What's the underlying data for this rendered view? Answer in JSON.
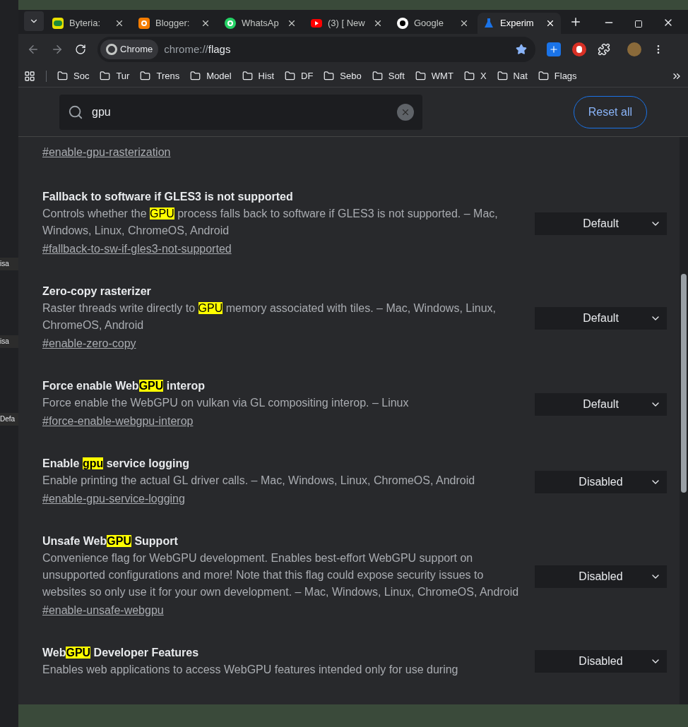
{
  "background_window": {
    "fragments": [
      "isa",
      "isa",
      "Defa"
    ]
  },
  "tabs": [
    {
      "title": "Byteria:",
      "selected": false
    },
    {
      "title": "Blogger:",
      "selected": false
    },
    {
      "title": "WhatsAp",
      "selected": false
    },
    {
      "title": "(3) [ New",
      "selected": false
    },
    {
      "title": "Google",
      "selected": false
    },
    {
      "title": "Experim",
      "selected": true
    }
  ],
  "toolbar": {
    "site_chip": "Chrome",
    "url_scheme": "chrome://",
    "url_path": "flags"
  },
  "bookmarks": [
    "Soc",
    "Tur",
    "Trens",
    "Model",
    "Hist",
    "DF",
    "Sebo",
    "Soft",
    "WMT",
    "X",
    "Nat",
    "Flags"
  ],
  "search": {
    "value": "gpu"
  },
  "reset_button": "Reset all",
  "flags": [
    {
      "link": "#enable-gpu-rasterization"
    },
    {
      "title": {
        "before": "Fallback to software if GLES3 is not supported"
      },
      "description": {
        "before": "Controls whether the ",
        "match": "GPU",
        "after": " process falls back to software if GLES3 is not supported. – Mac, Windows, Linux, ChromeOS, Android"
      },
      "link": "#fallback-to-sw-if-gles3-not-supported",
      "select": "Default"
    },
    {
      "title": {
        "before": "Zero-copy rasterizer"
      },
      "description": {
        "before": "Raster threads write directly to ",
        "match": "GPU",
        "after": " memory associated with tiles. – Mac, Windows, Linux, ChromeOS, Android"
      },
      "link": "#enable-zero-copy",
      "select": "Default"
    },
    {
      "title": {
        "before": "Force enable Web",
        "match": "GPU",
        "after": " interop"
      },
      "description": {
        "before": "Force enable the WebGPU on vulkan via GL compositing interop. – Linux"
      },
      "link": "#force-enable-webgpu-interop",
      "select": "Default"
    },
    {
      "title": {
        "before": "Enable ",
        "match": "gpu",
        "after": " service logging"
      },
      "description": {
        "before": "Enable printing the actual GL driver calls. – Mac, Windows, Linux, ChromeOS, Android"
      },
      "link": "#enable-gpu-service-logging",
      "select": "Disabled"
    },
    {
      "title": {
        "before": "Unsafe Web",
        "match": "GPU",
        "after": " Support"
      },
      "description": {
        "before": "Convenience flag for WebGPU development. Enables best-effort WebGPU support on unsupported configurations and more! Note that this flag could expose security issues to websites so only use it for your own development. – Mac, Windows, Linux, ChromeOS, Android"
      },
      "link": "#enable-unsafe-webgpu",
      "select": "Disabled"
    },
    {
      "title": {
        "before": "Web",
        "match": "GPU",
        "after": " Developer Features"
      },
      "description": {
        "before": "Enables web applications to access WebGPU features intended only for use during"
      },
      "select": "Disabled"
    }
  ]
}
